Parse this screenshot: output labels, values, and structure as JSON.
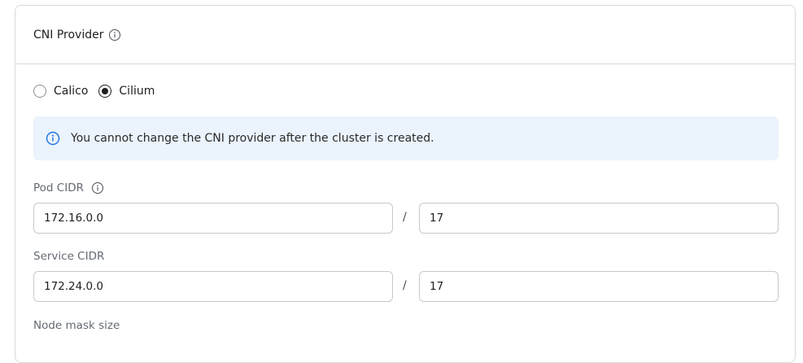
{
  "cni": {
    "title": "CNI Provider",
    "info_icon": "info-icon",
    "options": [
      {
        "label": "Calico",
        "selected": false
      },
      {
        "label": "Cilium",
        "selected": true
      }
    ],
    "alert": {
      "icon": "info-icon",
      "text": "You cannot change the CNI provider after the cluster is created.",
      "background": "#ebf3fc",
      "icon_color": "#1a73e8"
    }
  },
  "pod_cidr": {
    "label": "Pod CIDR",
    "info_icon": "info-icon",
    "address": "172.16.0.0",
    "separator": "/",
    "prefix": "17"
  },
  "service_cidr": {
    "label": "Service CIDR",
    "address": "172.24.0.0",
    "separator": "/",
    "prefix": "17"
  },
  "node_mask": {
    "label": "Node mask size"
  }
}
